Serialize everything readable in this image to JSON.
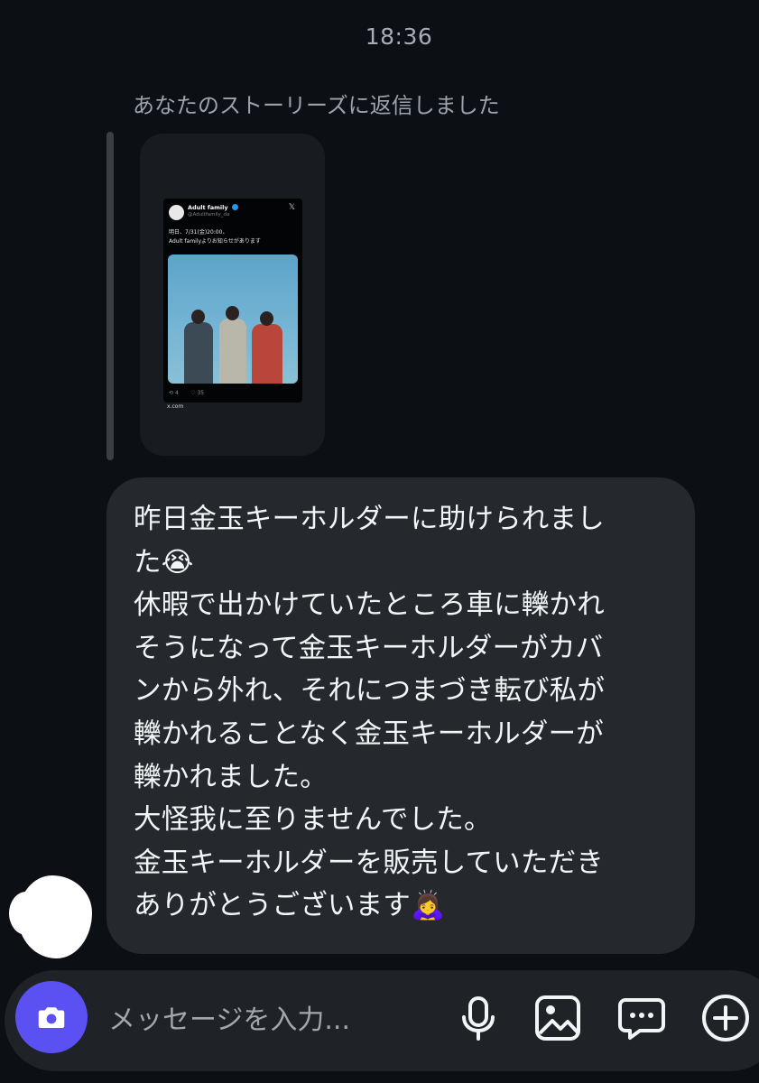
{
  "header": {
    "timestamp": "18:36"
  },
  "reply": {
    "label": "あなたのストーリーズに返信しました"
  },
  "story": {
    "tweet": {
      "name": "Adult family",
      "handle": "@Adultfamily_da",
      "text_line1": "明日、7/31(金)20:00、",
      "text_line2": "Adult familyよりお知らせがあります",
      "retweets": "4",
      "likes": "35",
      "domain": "x.com"
    }
  },
  "message": {
    "lines": [
      "昨日金玉キーホルダーに助けられまし",
      "た😭",
      "休暇で出かけていたところ車に轢かれ",
      "そうになって金玉キーホルダーがカバ",
      "ンから外れ、それにつまづき転び私が",
      "轢かれることなく金玉キーホルダーが",
      "轢かれました。",
      "大怪我に至りませんでした。",
      "金玉キーホルダーを販売していただき",
      "ありがとうございます🙇‍♀️"
    ]
  },
  "composer": {
    "placeholder": "メッセージを入力...",
    "accent_color": "#5b51f2",
    "icons": [
      "camera-icon",
      "microphone-icon",
      "gallery-icon",
      "sticker-icon",
      "plus-icon"
    ]
  }
}
